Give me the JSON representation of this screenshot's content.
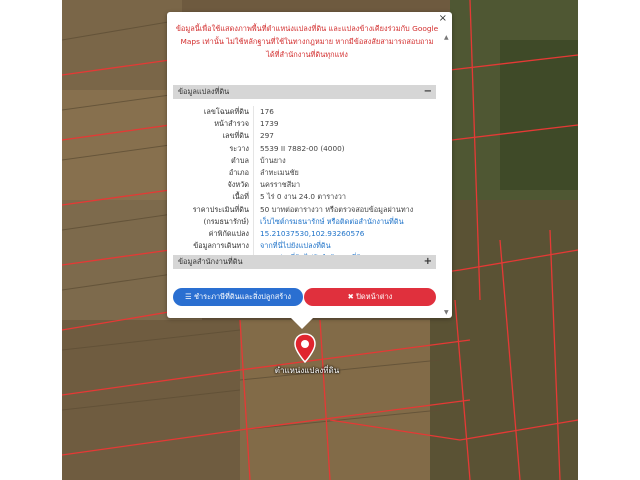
{
  "popup": {
    "notice": "ข้อมูลนี้เพื่อใช้แสดงภาพพื้นที่ตำแหน่งแปลงที่ดิน และแปลงข้างเคียงร่วมกับ Google Maps เท่านั้น ไม่ใช้หลักฐานที่ใช้ในทางกฎหมาย หากมีข้อสงสัยสามารถสอบถามได้ที่สำนักงานที่ดินทุกแห่ง",
    "close_symbol": "×",
    "section_land": {
      "title": "ข้อมูลแปลงที่ดิน",
      "sign": "−"
    },
    "section_office": {
      "title": "ข้อมูลสำนักงานที่ดิน",
      "sign": "+"
    },
    "fields": [
      {
        "label": "เลขโฉนดที่ดิน",
        "value": "176"
      },
      {
        "label": "หน้าสำรวจ",
        "value": "1739"
      },
      {
        "label": "เลขที่ดิน",
        "value": "297"
      },
      {
        "label": "ระวาง",
        "value": "5539 II 7882-00 (4000)"
      },
      {
        "label": "ตำบล",
        "value": "บ้านยาง"
      },
      {
        "label": "อำเภอ",
        "value": "ลำทะเมนชัย"
      },
      {
        "label": "จังหวัด",
        "value": "นครราชสีมา"
      },
      {
        "label": "เนื้อที่",
        "value": "5 ไร่ 0 งาน 24.0 ตารางวา"
      },
      {
        "label": "ราคาประเมินที่ดิน",
        "value": "50 บาทต่อตารางวา หรือตรวจสอบข้อมูลผ่านทาง"
      },
      {
        "label": "(กรมธนารักษ์)",
        "value": "เว็บไซต์กรมธนารักษ์ หรือติดต่อสำนักงานที่ดิน"
      },
      {
        "label": "ค่าพิกัดแปลง",
        "value": "15.21037530,102.93260576"
      },
      {
        "label": "ข้อมูลการเดินทาง",
        "value": "จากที่นี่ไปยังแปลงที่ดิน"
      },
      {
        "label": "",
        "value": "จากแปลงที่ดินไปยังสำนักงานที่ดิน"
      }
    ],
    "btn_pay": "ชำระภาษีที่ดินและสิ่งปลูกสร้าง",
    "btn_close": "ปิดหน้าต่าง"
  },
  "map": {
    "pin_label": "ตำแหน่งแปลงที่ดิน"
  }
}
